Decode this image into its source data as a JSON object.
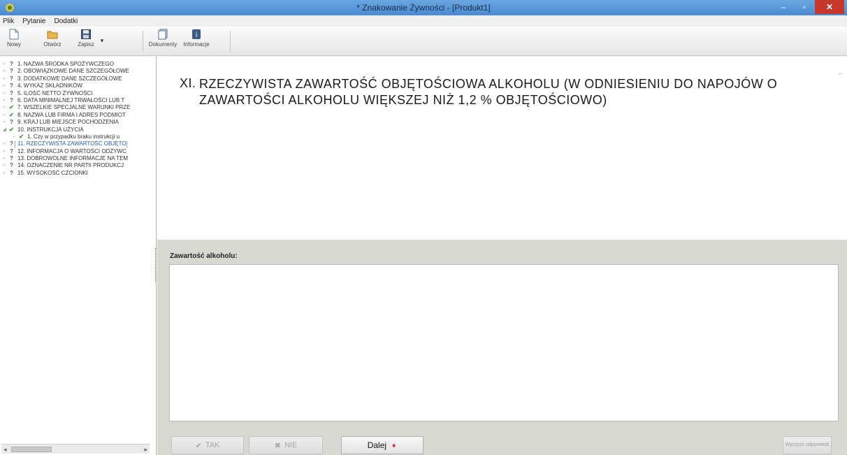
{
  "window": {
    "title": "* Znakowanie Żywności - [Produkt1]",
    "controls": {
      "minimize": "–",
      "maximize": "▫",
      "close": "✕"
    }
  },
  "menu": [
    "Plik",
    "Pytanie",
    "Dodatki"
  ],
  "toolbar": {
    "buttons": [
      {
        "label": "Nowy",
        "icon": "new-document-icon"
      },
      {
        "label": "Otwórz",
        "icon": "open-folder-icon"
      },
      {
        "label": "Zapisz",
        "icon": "save-disk-icon"
      },
      {
        "label": "Dokumenty",
        "icon": "documents-icon"
      },
      {
        "label": "Informacje",
        "icon": "info-icon"
      }
    ],
    "dropdown_arrow": "▾"
  },
  "tree": {
    "items": [
      {
        "label": "1. NAZWA ŚRODKA SPOŻYWCZEGO",
        "status": "?"
      },
      {
        "label": "2. OBOWIĄZKOWE DANE SZCZEGÓŁOWE",
        "status": "?"
      },
      {
        "label": "3. DODATKOWE DANE SZCZEGÓŁOWE",
        "status": "?"
      },
      {
        "label": "4. WYKAZ SKŁADNIKÓW",
        "status": "?"
      },
      {
        "label": "5. ILOŚĆ NETTO ŻYWNOŚCI",
        "status": "?"
      },
      {
        "label": "6. DATA MINIMALNEJ TRWAŁOŚCI LUB T",
        "status": "?"
      },
      {
        "label": "7. WSZELKIE SPECJALNE WARUNKI PRZE",
        "status": "✔"
      },
      {
        "label": "8. NAZWA LUB FIRMA I ADRES PODMIOT",
        "status": "✔"
      },
      {
        "label": "9. KRAJ LUB MIEJSCE POCHODZENIA",
        "status": "?"
      },
      {
        "label": "10. INSTRUKCJA UŻYCIA",
        "status": "✔"
      },
      {
        "label": "1. Czy w przypadku braku instrukcji u",
        "status": "✔",
        "child": true
      },
      {
        "label": "11. RZECZYWISTA ZAWARTOŚĆ OBJĘTO",
        "status": "?",
        "selected": true
      },
      {
        "label": "12. INFORMACJA O WARTOŚCI ODŻYWC",
        "status": "?"
      },
      {
        "label": "13. DOBROWOLNE INFORMACJE NA TEM",
        "status": "?"
      },
      {
        "label": "14. OZNACZENIE NR PARTII PRODUKCJ",
        "status": "?"
      },
      {
        "label": "15. WYSOKOŚĆ CZCIONKI",
        "status": "?"
      }
    ]
  },
  "question": {
    "number": "XI.",
    "text": "RZECZYWISTA ZAWARTOŚĆ OBJĘTOŚCIOWA ALKOHOLU (W ODNIESIENIU DO NAPOJÓW O ZAWARTOŚCI ALKOHOLU WIĘKSZEJ NIŻ 1,2 % OBJĘTOŚCIOWO)"
  },
  "answer": {
    "label": "Zawartość alkoholu:",
    "value": ""
  },
  "buttons": {
    "yes": "TAK",
    "no": "NIE",
    "next": "Dalej",
    "small": "Wyczyść odpowiedź"
  },
  "colors": {
    "titlebar": "#5a9ad9",
    "check": "#2a9d2a",
    "selected": "#2060b0",
    "close": "#c7382b",
    "next_arrow": "#d12a2a"
  }
}
